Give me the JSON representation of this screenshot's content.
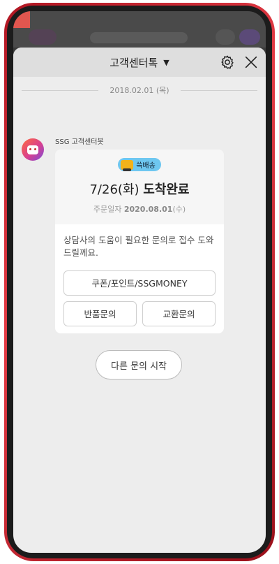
{
  "header": {
    "title": "고객센터톡",
    "caret": "▼"
  },
  "chat": {
    "date": "2018.02.01 (목)",
    "bot_name": "SSG 고객센터봇"
  },
  "card": {
    "badge_label": "쓱배송",
    "status_prefix": "7/26(화)",
    "status_main": "도착완료",
    "order_label": "주문일자",
    "order_date": "2020.08.01",
    "order_weekday": "(수)",
    "message": "상담사의 도움이 필요한 문의로 접수 도와드릴께요.",
    "buttons": {
      "coupon": "쿠폰/포인트/SSGMONEY",
      "return": "반품문의",
      "exchange": "교환문의"
    }
  },
  "restart_button": "다른 문의 시작",
  "colors": {
    "phone_frame": "#c41e2a",
    "badge": "#6ec7f0",
    "sheet_bg": "#ededed"
  }
}
